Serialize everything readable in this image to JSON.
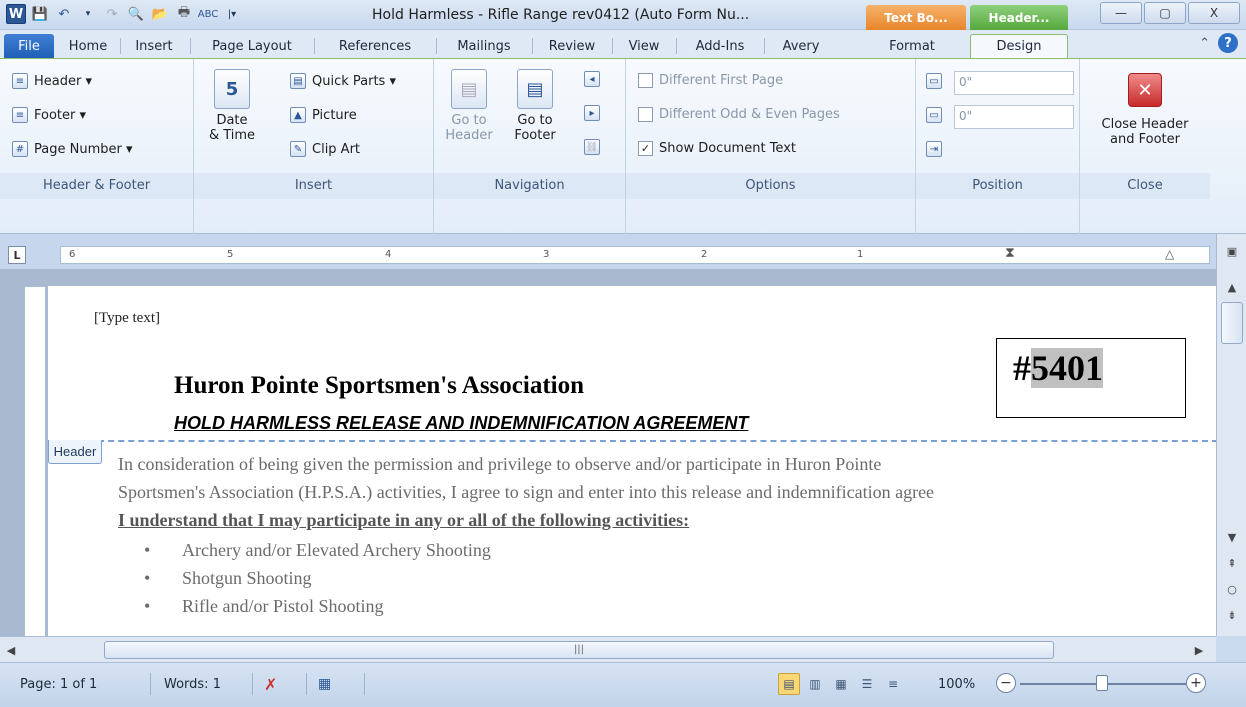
{
  "title_bar": {
    "title": "Hold Harmless - Rifle Range rev0412 (Auto Form Nu...",
    "contextual_tabs": [
      "Text Bo...",
      "Header..."
    ],
    "minimize": "—",
    "maximize": "▢",
    "close": "X"
  },
  "tabs": {
    "file": "File",
    "home": "Home",
    "insert": "Insert",
    "page_layout": "Page Layout",
    "references": "References",
    "mailings": "Mailings",
    "review": "Review",
    "view": "View",
    "add_ins": "Add-Ins",
    "avery": "Avery",
    "format": "Format",
    "design": "Design"
  },
  "ribbon": {
    "header_footer": {
      "label": "Header & Footer",
      "header": "Header ▾",
      "footer": "Footer ▾",
      "page_number": "Page Number ▾"
    },
    "insert": {
      "label": "Insert",
      "date_time_1": "Date",
      "date_time_2": "& Time",
      "quick_parts": "Quick Parts ▾",
      "picture": "Picture",
      "clip_art": "Clip Art"
    },
    "navigation": {
      "label": "Navigation",
      "goto_header_1": "Go to",
      "goto_header_2": "Header",
      "goto_footer_1": "Go to",
      "goto_footer_2": "Footer"
    },
    "options": {
      "label": "Options",
      "diff_first": "Different First Page",
      "diff_odd_even": "Different Odd & Even Pages",
      "show_doc_text": "Show Document Text",
      "show_doc_text_checked": true
    },
    "position": {
      "label": "Position",
      "header_from_top": "0\"",
      "footer_from_bottom": "0\""
    },
    "close": {
      "label": "Close",
      "close_1": "Close Header",
      "close_2": "and Footer"
    }
  },
  "ruler": {
    "numbers": [
      "6",
      "5",
      "4",
      "3",
      "2",
      "1"
    ]
  },
  "document": {
    "type_text": "[Type text]",
    "org_name": "Huron Pointe Sportsmen's  Association",
    "subtitle": "HOLD HARMLESS RELEASE AND INDEMNIFICATION AGREEMENT",
    "form_number_prefix": "#",
    "form_number": "5401",
    "header_tab": "Header",
    "para1": "In consideration of being given the permission and privilege to observe and/or participate in Huron Pointe",
    "para2": "Sportsmen's Association (H.P.S.A.) activities, I agree to sign and enter into this release and indemnification agree",
    "underline_line": "I understand that I may participate in any or all of the following activities:",
    "bullets": [
      "Archery and/or Elevated Archery Shooting",
      "Shotgun Shooting",
      "Rifle and/or Pistol Shooting"
    ]
  },
  "status_bar": {
    "page": "Page: 1 of 1",
    "words": "Words: 1",
    "zoom": "100%"
  }
}
